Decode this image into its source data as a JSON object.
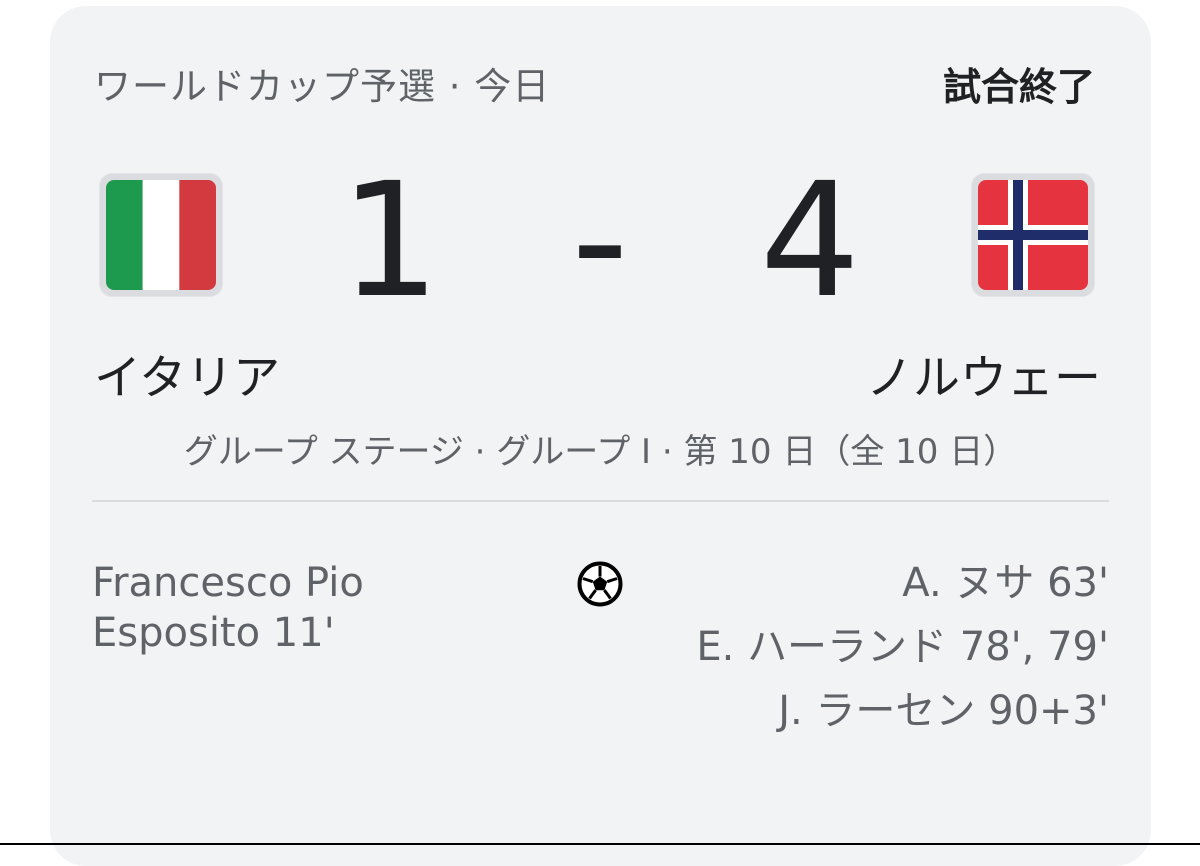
{
  "header": {
    "competition": "ワールドカップ予選 · 今日",
    "status": "試合終了"
  },
  "match": {
    "home": {
      "name": "イタリア",
      "flag": "italy-flag",
      "score": "1",
      "scorers": [
        "Francesco Pio Esposito 11'"
      ]
    },
    "separator": "-",
    "away": {
      "name": "ノルウェー",
      "flag": "norway-flag",
      "score": "4",
      "scorers": [
        "A. ヌサ 63'",
        "E. ハーランド 78', 79'",
        "J. ラーセン 90+3'"
      ]
    },
    "stage": "グループ ステージ · グループ I · 第 10 日（全 10 日）"
  },
  "icons": {
    "goal": "soccer-ball-icon"
  },
  "colors": {
    "card_background": "#f1f3f4",
    "primary_text": "#202124",
    "secondary_text": "#5f6368",
    "italy_green": "#1e9a4f",
    "italy_red": "#d23a3f",
    "norway_red": "#e5343f",
    "norway_blue": "#1f2e6b"
  }
}
